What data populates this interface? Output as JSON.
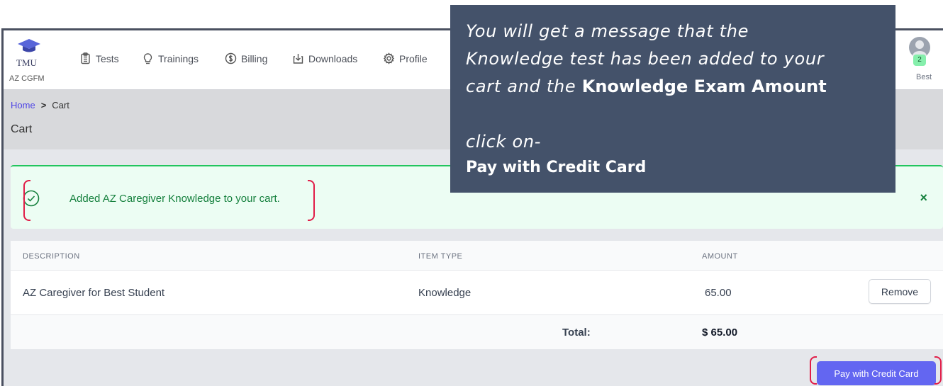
{
  "brand": {
    "logo_text": "TMU",
    "subtitle": "AZ CGFM"
  },
  "nav": [
    {
      "label": "Tests",
      "icon": "clipboard-icon"
    },
    {
      "label": "Trainings",
      "icon": "lightbulb-icon"
    },
    {
      "label": "Billing",
      "icon": "dollar-circle-icon"
    },
    {
      "label": "Downloads",
      "icon": "download-box-icon"
    },
    {
      "label": "Profile",
      "icon": "gear-icon"
    }
  ],
  "user": {
    "badge": "2",
    "name": "Best"
  },
  "breadcrumb": {
    "home": "Home",
    "separator": ">",
    "current": "Cart"
  },
  "page_title": "Cart",
  "alert": {
    "message": "Added AZ Caregiver Knowledge to your cart.",
    "close": "×"
  },
  "table": {
    "headers": {
      "description": "DESCRIPTION",
      "item_type": "ITEM TYPE",
      "amount": "AMOUNT"
    },
    "rows": [
      {
        "description": "AZ Caregiver for Best Student",
        "item_type": "Knowledge",
        "amount": "65.00",
        "action": "Remove"
      }
    ],
    "total_label": "Total:",
    "total_value": "$ 65.00"
  },
  "pay_button": "Pay with Credit Card",
  "callout": {
    "line1": "You will get a message that the",
    "line2": "Knowledge test has been added to your",
    "line3_italic": "cart and the",
    "line3_bold": "Knowledge Exam Amount",
    "line4": "click on-",
    "line5": "Pay with Credit Card"
  },
  "colors": {
    "accent": "#6366f1",
    "success": "#15803d",
    "callout_bg": "#44526a",
    "annotation": "#e11d48"
  }
}
